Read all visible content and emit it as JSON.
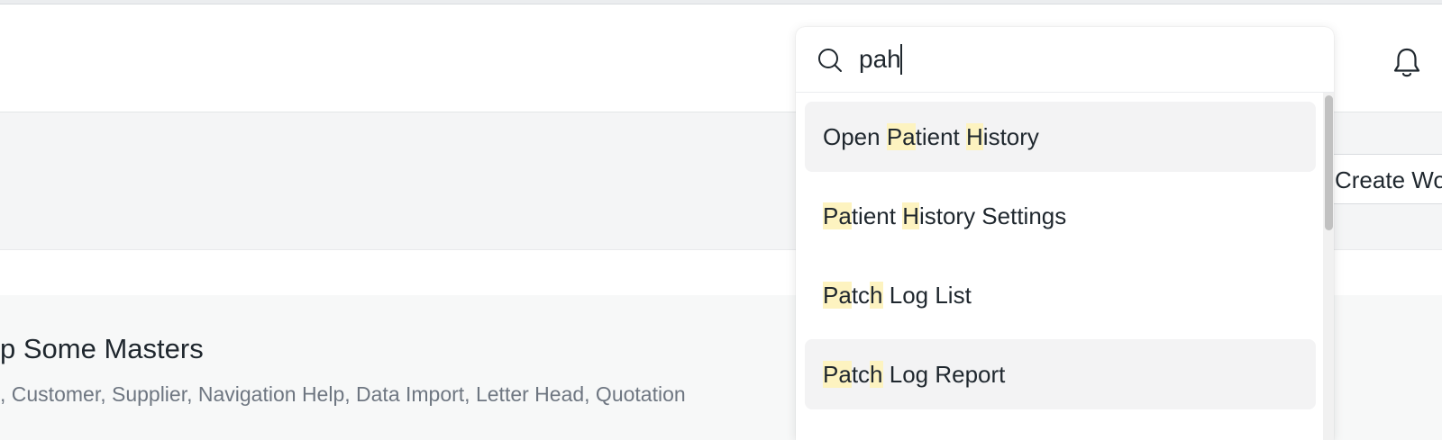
{
  "header": {
    "notifications_icon": "bell-icon"
  },
  "page_head": {
    "create_button_label": "Create Wo"
  },
  "masters": {
    "title": "p Some Masters",
    "subtitle": ", Customer, Supplier, Navigation Help, Data Import, Letter Head, Quotation"
  },
  "search": {
    "icon": "search-icon",
    "query": "pah",
    "results": [
      {
        "segments": [
          {
            "t": "Open ",
            "h": false
          },
          {
            "t": "Pa",
            "h": true
          },
          {
            "t": "tient ",
            "h": false
          },
          {
            "t": "H",
            "h": true
          },
          {
            "t": "istory",
            "h": false
          }
        ],
        "label": "Open Patient History"
      },
      {
        "segments": [
          {
            "t": "Pa",
            "h": true
          },
          {
            "t": "tient ",
            "h": false
          },
          {
            "t": "H",
            "h": true
          },
          {
            "t": "istory Settings",
            "h": false
          }
        ],
        "label": "Patient History Settings"
      },
      {
        "segments": [
          {
            "t": "Pa",
            "h": true
          },
          {
            "t": "tc",
            "h": false
          },
          {
            "t": "h",
            "h": true
          },
          {
            "t": " Log List",
            "h": false
          }
        ],
        "label": "Patch Log List"
      },
      {
        "segments": [
          {
            "t": "Pa",
            "h": true
          },
          {
            "t": "tc",
            "h": false
          },
          {
            "t": "h",
            "h": true
          },
          {
            "t": " Log Report",
            "h": false
          }
        ],
        "label": "Patch Log Report"
      }
    ]
  },
  "colors": {
    "highlight": "#fdf3c0",
    "hover_row": "#f3f3f4",
    "text": "#1f272e",
    "muted": "#6e7681"
  }
}
